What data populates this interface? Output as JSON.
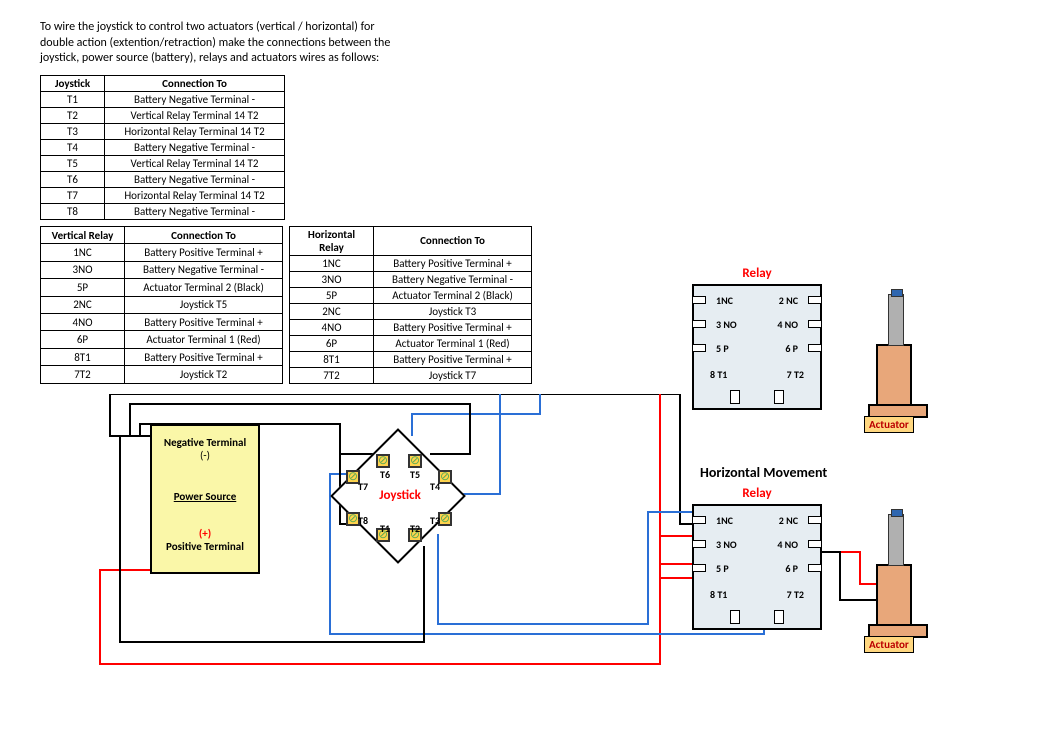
{
  "intro": "To wire the joystick to control two actuators (vertical / horizontal) for double action (extention/retraction) make the connections between the joystick, power source (battery), relays and actuators wires as follows:",
  "table_joystick": {
    "headers": [
      "Joystick",
      "Connection To"
    ],
    "rows": [
      [
        "T1",
        "Battery Negative  Terminal -"
      ],
      [
        "T2",
        "Vertical Relay Terminal 14 T2"
      ],
      [
        "T3",
        "Horizontal Relay Terminal 14 T2"
      ],
      [
        "T4",
        "Battery Negative  Terminal -"
      ],
      [
        "T5",
        "Vertical Relay Terminal 14 T2"
      ],
      [
        "T6",
        "Battery Negative  Terminal -"
      ],
      [
        "T7",
        "Horizontal Relay Terminal 14 T2"
      ],
      [
        "T8",
        "Battery Negative  Terminal -"
      ]
    ]
  },
  "table_vrelay": {
    "headers": [
      "Vertical Relay",
      "Connection To"
    ],
    "rows": [
      [
        "1NC",
        "Battery Positive Terminal +"
      ],
      [
        "3NO",
        "Battery Negative  Terminal -"
      ],
      [
        "5P",
        "Actuator Terminal 2 (Black)"
      ],
      [
        "2NC",
        "Joystick T5"
      ],
      [
        "4NO",
        "Battery Positive Terminal +"
      ],
      [
        "6P",
        "Actuator Terminal 1 (Red)"
      ],
      [
        "8T1",
        "Battery Positive Terminal +"
      ],
      [
        "7T2",
        "Joystick T2"
      ]
    ]
  },
  "table_hrelay": {
    "headers": [
      "Horizontal Relay",
      "Connection To"
    ],
    "rows": [
      [
        "1NC",
        "Battery Positive Terminal +"
      ],
      [
        "3NO",
        "Battery Negative  Terminal -"
      ],
      [
        "5P",
        "Actuator Terminal 2 (Black)"
      ],
      [
        "2NC",
        "Joystick T3"
      ],
      [
        "4NO",
        "Battery Positive Terminal +"
      ],
      [
        "6P",
        "Actuator Terminal 1 (Red)"
      ],
      [
        "8T1",
        "Battery Positive Terminal +"
      ],
      [
        "7T2",
        "Joystick T7"
      ]
    ]
  },
  "power": {
    "neg": "Negative Terminal",
    "neg_sign": "(-)",
    "label": "Power Source",
    "pos_sign": "(+)",
    "pos": "Positive Terminal"
  },
  "joystick": {
    "title": "Joystick",
    "terms": {
      "t1": "T1",
      "t2": "T2",
      "t3": "T3",
      "t4": "T4",
      "t5": "T5",
      "t6": "T6",
      "t7": "T7",
      "t8": "T8"
    }
  },
  "relay": {
    "title": "Relay",
    "pins": {
      "nc1": "1NC",
      "nc2": "2 NC",
      "no3": "3 NO",
      "no4": "4 NO",
      "p5": "5 P",
      "p6": "6 P",
      "t1": "8 T1",
      "t2": "7 T2"
    }
  },
  "hmove": "Horizontal Movement",
  "actuator_label": "Actuator"
}
